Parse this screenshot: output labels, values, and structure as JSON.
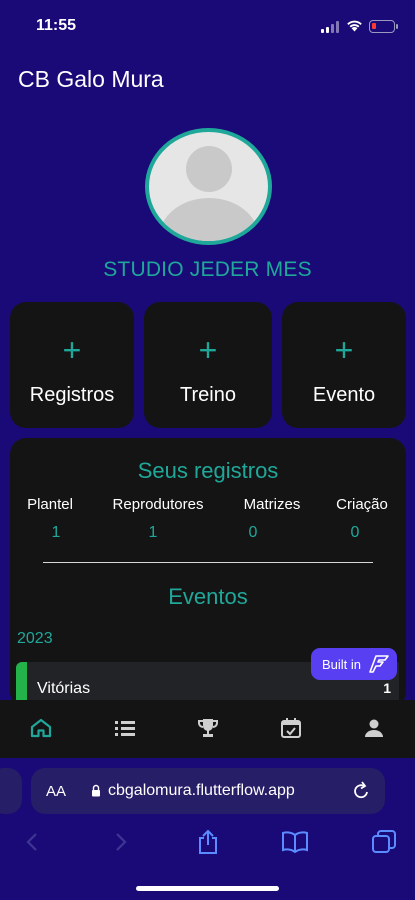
{
  "status_bar": {
    "time": "11:55"
  },
  "app": {
    "title": "CB Galo Mura"
  },
  "profile": {
    "name": "STUDIO JEDER MES"
  },
  "actions": [
    {
      "label": "Registros",
      "icon": "plus-icon"
    },
    {
      "label": "Treino",
      "icon": "plus-icon"
    },
    {
      "label": "Evento",
      "icon": "plus-icon"
    }
  ],
  "records": {
    "title": "Seus registros",
    "stats": [
      {
        "label": "Plantel",
        "value": "1"
      },
      {
        "label": "Reprodutores",
        "value": "1"
      },
      {
        "label": "Matrizes",
        "value": "0"
      },
      {
        "label": "Criação",
        "value": "0"
      }
    ]
  },
  "events": {
    "title": "Eventos",
    "year": "2023",
    "rows": [
      {
        "label": "Vitórias",
        "count": "1"
      }
    ]
  },
  "badge": {
    "label": "Built in"
  },
  "bottom_nav": [
    "home-icon",
    "list-icon",
    "trophy-icon",
    "calendar-check-icon",
    "person-icon"
  ],
  "browser": {
    "aa_label": "AA",
    "url": "cbgalomura.flutterflow.app"
  },
  "colors": {
    "background": "#1a0a78",
    "accent": "#1fa89a",
    "card": "#141414",
    "badge": "#5840f2",
    "event_accent": "#24b24a"
  }
}
